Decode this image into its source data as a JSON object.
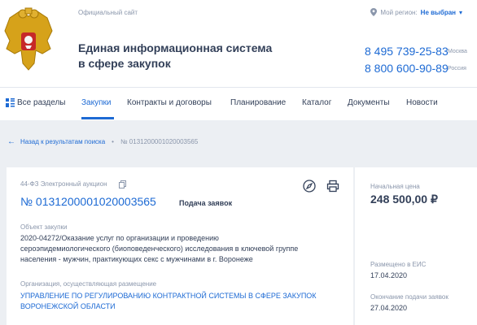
{
  "header": {
    "official_site": "Официальный сайт",
    "title_line1": "Единая информационная система",
    "title_line2": "в сфере закупок",
    "region_label": "Мой регион:",
    "region_value": "Не выбран",
    "phones": [
      {
        "number": "8 495 739-25-83",
        "note": "Москва"
      },
      {
        "number": "8 800 600-90-89",
        "note": "Россия"
      }
    ]
  },
  "nav": {
    "items": [
      "Все разделы",
      "Закупки",
      "Контракты и договоры",
      "Планирование",
      "Каталог",
      "Документы",
      "Новости"
    ],
    "active": "Закупки"
  },
  "breadcrumbs": {
    "back": "Назад к результатам поиска",
    "current": "№ 0131200001020003565"
  },
  "purchase": {
    "law_type": "44-ФЗ Электронный аукцион",
    "number": "№ 0131200001020003565",
    "status": "Подача заявок",
    "object_label": "Объект закупки",
    "object_lines": [
      "2020-04272/Оказание услуг по организации и проведению",
      "сероэпидемиологического (биоповеденческого) исследования в ключевой группе",
      "населения - мужчин, практикующих секс с мужчинами в г. Воронеже"
    ],
    "org_label": "Организация, осуществляющая размещение",
    "org_lines": [
      "УПРАВЛЕНИЕ ПО РЕГУЛИРОВАНИЮ КОНТРАКТНОЙ СИСТЕМЫ В СФЕРЕ ЗАКУПОК",
      "ВОРОНЕЖСКОЙ ОБЛАСТИ"
    ]
  },
  "side": {
    "price_label": "Начальная цена",
    "price": "248 500,00 ₽",
    "posted_label": "Размещено в ЕИС",
    "posted": "17.04.2020",
    "deadline_label": "Окончание подачи заявок",
    "deadline": "27.04.2020"
  },
  "colors": {
    "accent": "#1d6ad4",
    "text": "#334059",
    "muted": "#8a96ab",
    "background": "#eceff3"
  }
}
